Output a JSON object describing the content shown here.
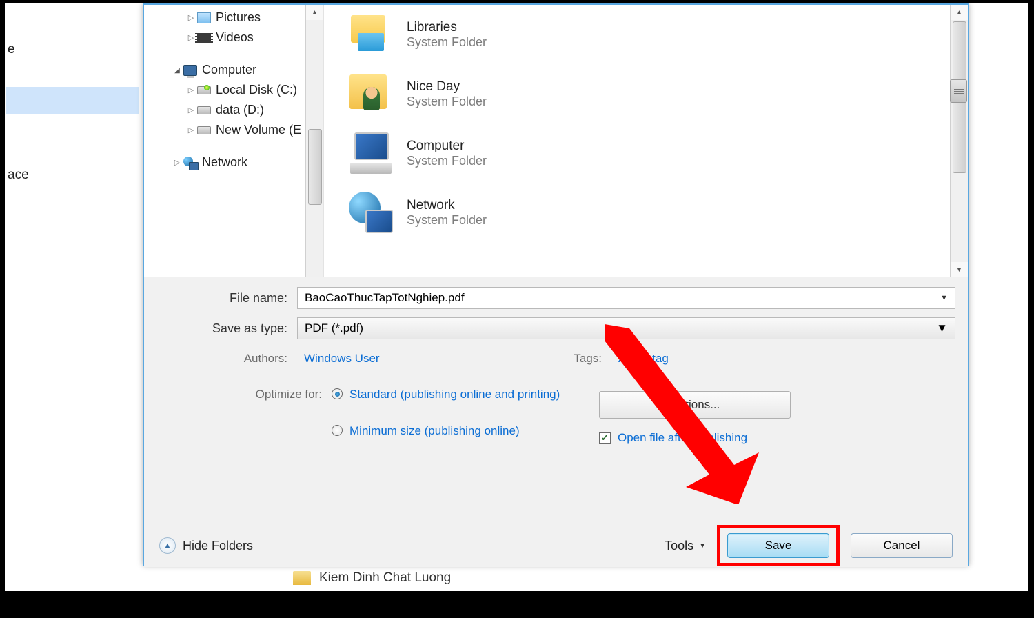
{
  "background": {
    "partial_e": "e",
    "partial_ace": "ace",
    "bottom_item": "Kiem Dinh Chat Luong"
  },
  "nav": {
    "items": [
      {
        "label": "Pictures",
        "level": 2,
        "icon": "pictures",
        "arrow": "closed"
      },
      {
        "label": "Videos",
        "level": 2,
        "icon": "videos",
        "arrow": "closed"
      }
    ],
    "computer_group": {
      "label": "Computer",
      "children": [
        {
          "label": "Local Disk (C:)",
          "icon": "diskc"
        },
        {
          "label": "data (D:)",
          "icon": "disk"
        },
        {
          "label": "New Volume (E",
          "icon": "disk"
        }
      ]
    },
    "network_label": "Network"
  },
  "content": {
    "items": [
      {
        "name": "Libraries",
        "type": "System Folder",
        "icon": "libraries"
      },
      {
        "name": "Nice Day",
        "type": "System Folder",
        "icon": "userfolder"
      },
      {
        "name": "Computer",
        "type": "System Folder",
        "icon": "computer"
      },
      {
        "name": "Network",
        "type": "System Folder",
        "icon": "network"
      }
    ]
  },
  "form": {
    "file_name_label": "File name:",
    "file_name_value": "BaoCaoThucTapTotNghiep.pdf",
    "save_type_label": "Save as type:",
    "save_type_value": "PDF (*.pdf)",
    "authors_label": "Authors:",
    "authors_value": "Windows User",
    "tags_label": "Tags:",
    "tags_value": "Add a tag",
    "optimize_label": "Optimize for:",
    "optimize_standard": "Standard (publishing online and printing)",
    "optimize_minimum": "Minimum size (publishing online)",
    "options_button": "Options...",
    "open_after": "Open file after publishing",
    "hide_folders": "Hide Folders",
    "tools": "Tools",
    "save": "Save",
    "cancel": "Cancel"
  }
}
